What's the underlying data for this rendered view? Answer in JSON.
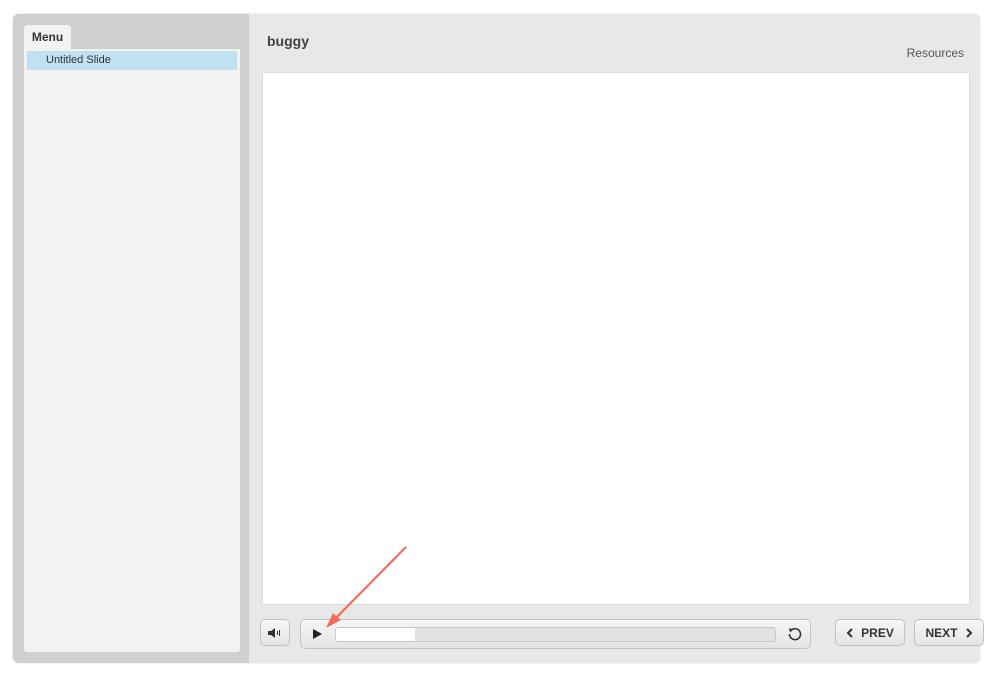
{
  "menu": {
    "tab_label": "Menu",
    "items": [
      {
        "label": "Untitled Slide",
        "selected": true
      }
    ]
  },
  "header": {
    "title": "buggy",
    "resources_label": "Resources"
  },
  "controls": {
    "prev_label": "PREV",
    "next_label": "NEXT",
    "seek_progress_percent": 18
  },
  "colors": {
    "selected_item": "#bfe1f2",
    "annotation_arrow": "#f26b5b"
  }
}
